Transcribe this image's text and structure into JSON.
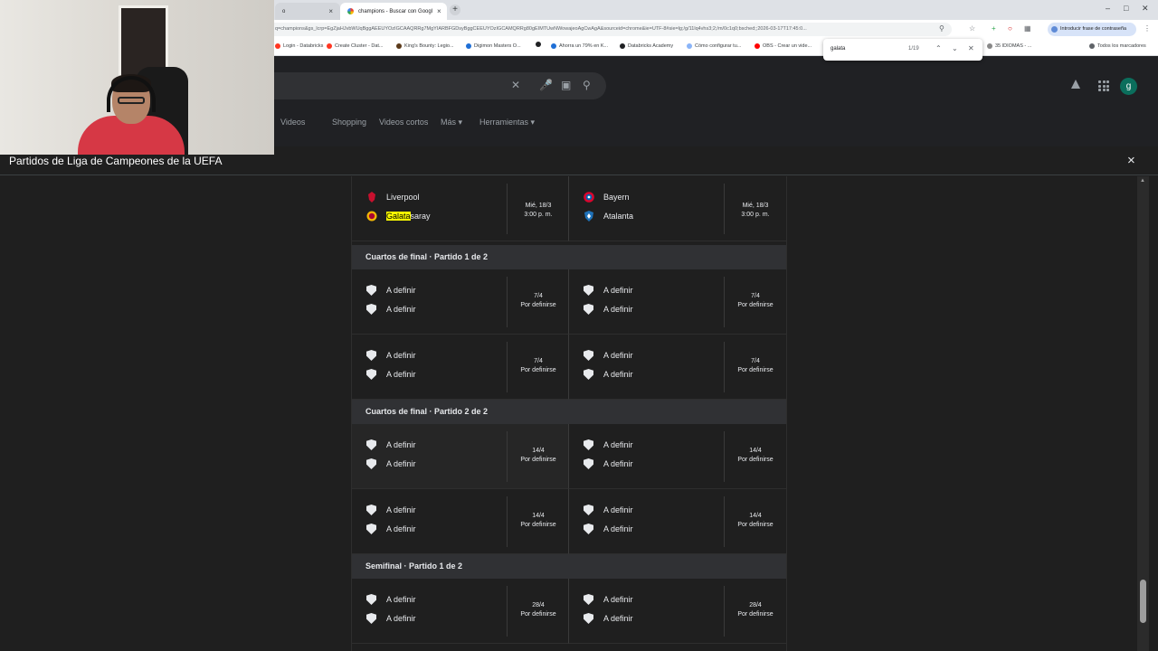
{
  "browser": {
    "tabs": [
      {
        "label": "o",
        "close": "×"
      },
      {
        "label": "champions - Buscar con Googl",
        "close": "×"
      }
    ],
    "new_tab": "+",
    "url": "q=champions&gs_lcrp=EgZjaHJvbWUqBggAEEUYOzIGCAAQRRg7MgYIARBFGDsyBggCEEUYOzIGCAMQRRg80gEIMTUwNWowajeoAgCwAgA&sourceid=chrome&ie=UTF-8#sie=lg;/g/11lq4vhs3;2;/m/0c1q0;bsched;;2026-03-17T17:45:0...",
    "password_pill": "Introducir frase de contraseña",
    "bookmarks": [
      {
        "label": "Login - Databricks",
        "color": "#ff3621"
      },
      {
        "label": "Create Cluster - Dat...",
        "color": "#ff3621"
      },
      {
        "label": "King's Bounty: Legio...",
        "color": "#5b3a1a"
      },
      {
        "label": "Digimon Masters O...",
        "color": "#1f6fd6"
      },
      {
        "label": "",
        "color": "#202124"
      },
      {
        "label": "Ahorra un 79% en K...",
        "color": "#1f6fd6"
      },
      {
        "label": "Databricks Academy",
        "color": "#202124"
      },
      {
        "label": "Cómo configurar tu...",
        "color": "#8ab4f8"
      },
      {
        "label": "OBS - Crear un vide...",
        "color": "#ff0000"
      },
      {
        "label": "35 IDIOMAS - ...",
        "color": "#888888"
      },
      {
        "label": "Todos los marcadores",
        "color": "#5f6368"
      }
    ],
    "find": {
      "query": "galata",
      "count": "1/19"
    }
  },
  "google": {
    "nav": [
      "Videos",
      "Shopping",
      "Videos cortos",
      "Más",
      "Herramientas"
    ],
    "avatar_letter": "g"
  },
  "dialog": {
    "title": "Partidos de Liga de Campeones de la UEFA",
    "close": "×",
    "top_matches": {
      "left": {
        "team1": "Liverpool",
        "team2_highlight": "Galata",
        "team2_rest": "saray",
        "date": "Mié, 18/3",
        "time": "3:00 p. m."
      },
      "right": {
        "team1": "Bayern",
        "team2": "Atalanta",
        "date": "Mié, 18/3",
        "time": "3:00 p. m."
      }
    },
    "tbd": "A definir",
    "status": "Por definirse",
    "rounds": [
      {
        "title": "Cuartos de final · Partido 1 de 2",
        "dates": [
          "7/4",
          "7/4",
          "7/4",
          "7/4"
        ]
      },
      {
        "title": "Cuartos de final · Partido 2 de 2",
        "dates": [
          "14/4",
          "14/4",
          "14/4",
          "14/4"
        ]
      },
      {
        "title": "Semifinal · Partido 1 de 2",
        "dates": [
          "28/4",
          "28/4"
        ]
      }
    ]
  }
}
